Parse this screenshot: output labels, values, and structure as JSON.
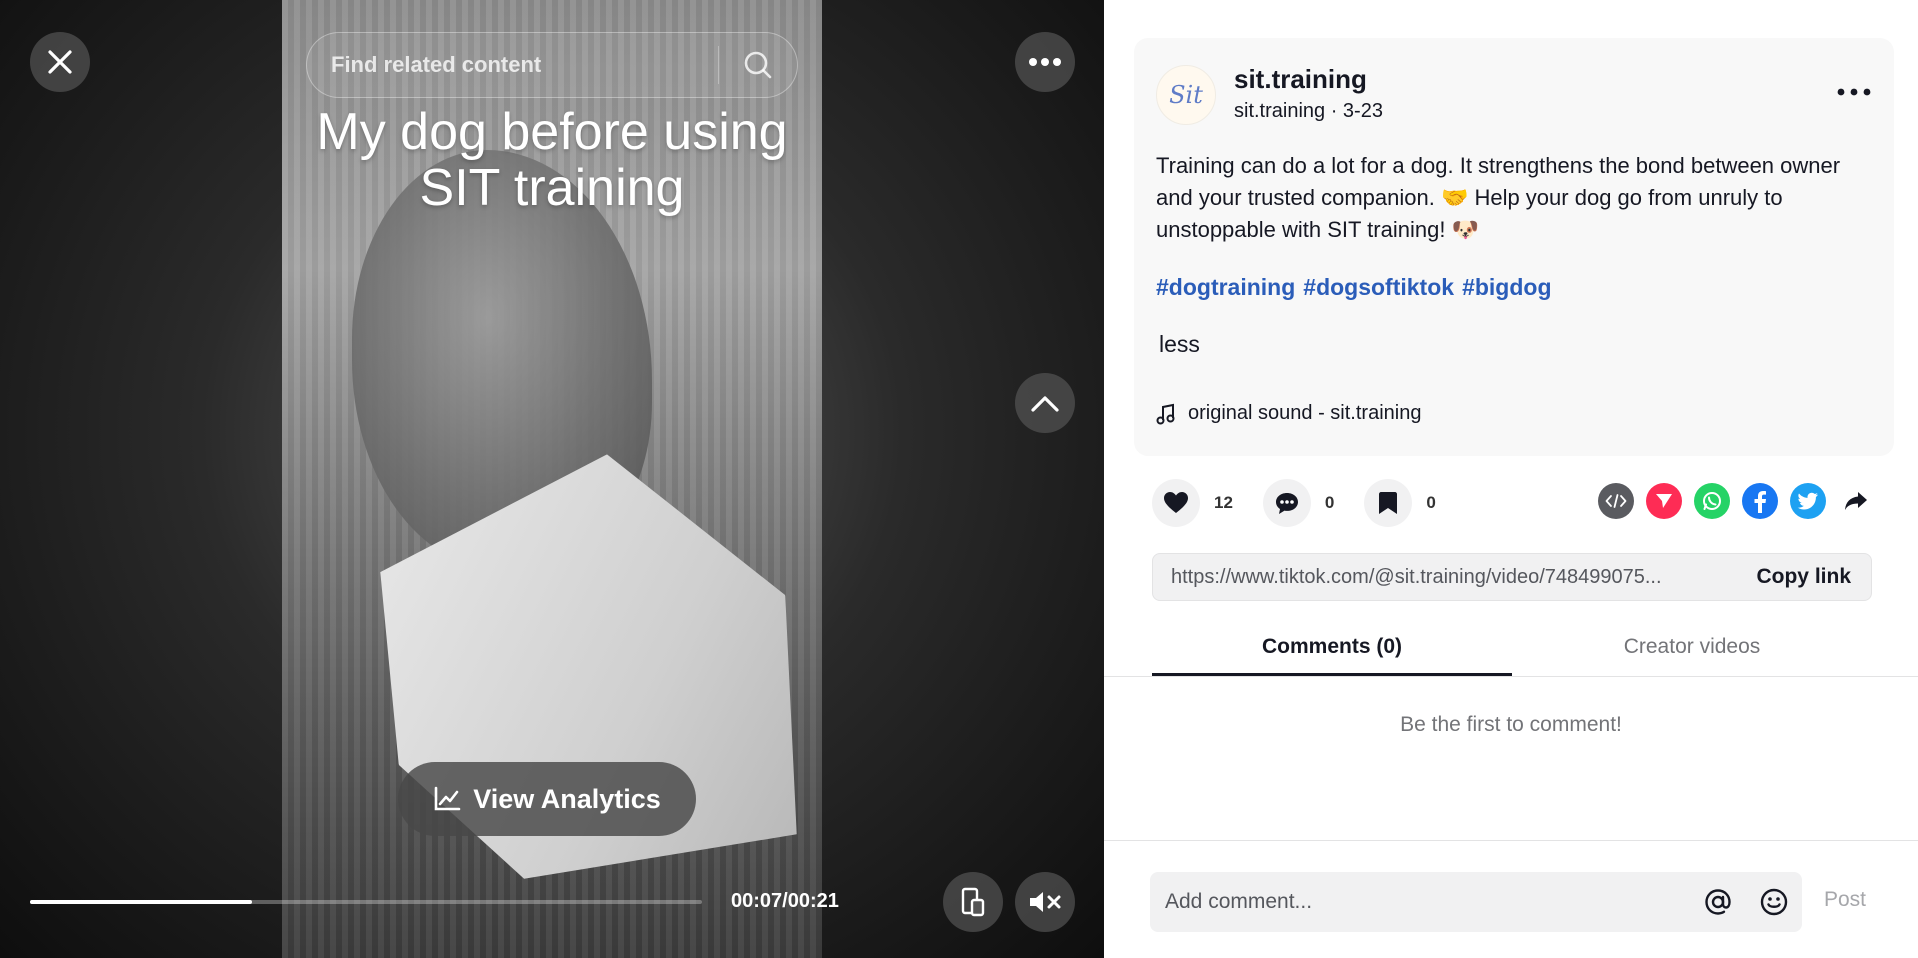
{
  "video": {
    "caption": "My dog before using SIT training",
    "search_placeholder": "Find related content",
    "analytics_label": "View Analytics",
    "time": "00:07/00:21",
    "progress_fraction": 0.33
  },
  "post": {
    "avatar_text": "Sit",
    "username": "sit.training",
    "subline": "sit.training · 3-23",
    "description": "Training can do a lot for a dog. It strengthens the bond between owner and your trusted companion. 🤝 Help your dog go from unruly to unstoppable with SIT training! 🐶",
    "hashtags": [
      "#dogtraining",
      "#dogsoftiktok",
      "#bigdog"
    ],
    "less_label": "less",
    "music": "original sound - sit.training"
  },
  "actions": {
    "likes": "12",
    "comments": "0",
    "saves": "0"
  },
  "share": {
    "icons": [
      "embed-icon",
      "send-icon",
      "whatsapp-icon",
      "facebook-icon",
      "twitter-icon",
      "share-arrow-icon"
    ],
    "colors": {
      "embed": "#5a5b60",
      "send": "#fe2c55",
      "whatsapp": "#25d366",
      "facebook": "#1877f2",
      "twitter": "#1da1f2"
    }
  },
  "link": {
    "url": "https://www.tiktok.com/@sit.training/video/748499075...",
    "copy_label": "Copy link"
  },
  "tabs": [
    {
      "label": "Comments (0)"
    },
    {
      "label": "Creator videos"
    }
  ],
  "comments": {
    "empty_text": "Be the first to comment!",
    "placeholder": "Add comment...",
    "post_label": "Post"
  },
  "colors": {
    "hashtag": "#2b5db9",
    "text": "#161823"
  }
}
